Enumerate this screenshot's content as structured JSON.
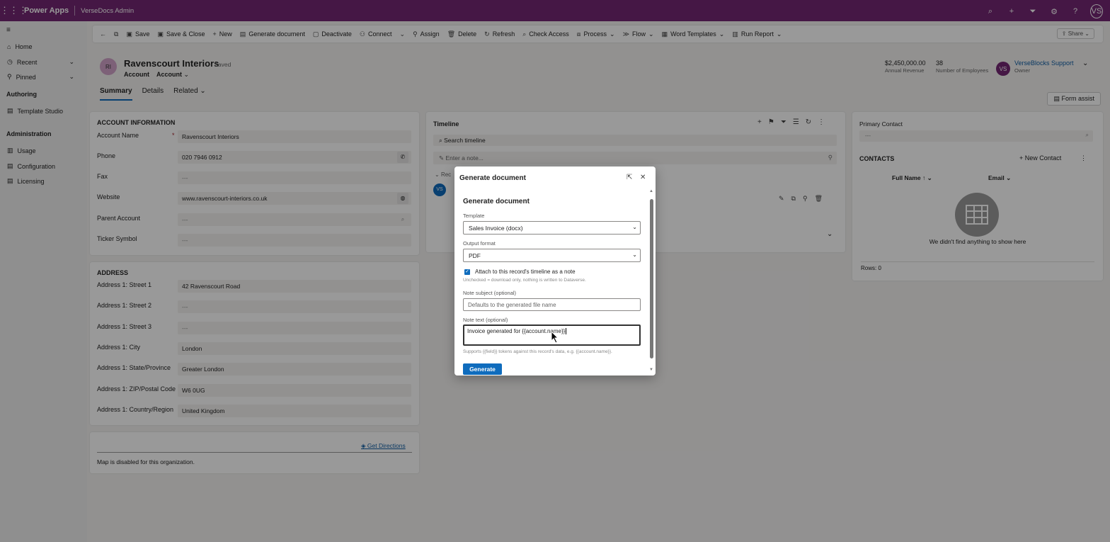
{
  "topbar": {
    "app": "Power Apps",
    "env": "VerseDocs Admin",
    "avatar": "VS"
  },
  "sitemap": {
    "items": [
      {
        "label": "Home",
        "icon": "home-icon"
      },
      {
        "label": "Recent",
        "icon": "clock-icon"
      },
      {
        "label": "Pinned",
        "icon": "pin-icon"
      }
    ],
    "authoring_title": "Authoring",
    "authoring_items": [
      {
        "label": "Template Studio"
      }
    ],
    "admin_title": "Administration",
    "admin_items": [
      {
        "label": "Usage"
      },
      {
        "label": "Configuration"
      },
      {
        "label": "Licensing"
      }
    ]
  },
  "cmdbar": {
    "save": "Save",
    "save_close": "Save & Close",
    "new": "New",
    "generate": "Generate document",
    "deactivate": "Deactivate",
    "connect": "Connect",
    "assign": "Assign",
    "delete": "Delete",
    "refresh": "Refresh",
    "check_access": "Check Access",
    "process": "Process",
    "flow": "Flow",
    "word_templates": "Word Templates",
    "run_report": "Run Report",
    "share": "Share"
  },
  "header": {
    "initials": "RI",
    "title": "Ravenscourt Interiors",
    "saved": "- Saved",
    "entity": "Account",
    "form": "Account",
    "revenue": "$2,450,000.00",
    "revenue_label": "Annual Revenue",
    "employees": "38",
    "employees_label": "Number of Employees",
    "owner_initials": "VS",
    "owner": "VerseBlocks Support",
    "owner_label": "Owner",
    "tabs": [
      "Summary",
      "Details",
      "Related"
    ],
    "form_assist": "Form assist"
  },
  "account_info": {
    "title": "ACCOUNT INFORMATION",
    "fields": [
      {
        "label": "Account Name",
        "value": "Ravenscourt Interiors"
      },
      {
        "label": "Phone",
        "value": "020 7946 0912"
      },
      {
        "label": "Fax",
        "value": "---"
      },
      {
        "label": "Website",
        "value": "www.ravenscourt-interiors.co.uk"
      },
      {
        "label": "Parent Account",
        "value": "---"
      },
      {
        "label": "Ticker Symbol",
        "value": "---"
      }
    ]
  },
  "address": {
    "title": "ADDRESS",
    "fields": [
      {
        "label": "Address 1: Street 1",
        "value": "42 Ravenscourt Road"
      },
      {
        "label": "Address 1: Street 2",
        "value": "---"
      },
      {
        "label": "Address 1: Street 3",
        "value": "---"
      },
      {
        "label": "Address 1: City",
        "value": "London"
      },
      {
        "label": "Address 1: State/Province",
        "value": "Greater London"
      },
      {
        "label": "Address 1: ZIP/Postal Code",
        "value": "W6 0UG"
      },
      {
        "label": "Address 1: Country/Region",
        "value": "United Kingdom"
      }
    ]
  },
  "map": {
    "directions": "Get Directions",
    "disabled": "Map is disabled for this organization."
  },
  "timeline": {
    "title": "Timeline",
    "search_placeholder": "Search timeline",
    "note_placeholder": "Enter a note...",
    "recent": "Rec",
    "avatar": "VS"
  },
  "contacts": {
    "primary_label": "Primary Contact",
    "primary_value": "---",
    "title": "CONTACTS",
    "new_contact": "New Contact",
    "col_name": "Full Name",
    "col_email": "Email",
    "empty": "We didn't find anything to show here",
    "rows": "Rows: 0"
  },
  "modal": {
    "title": "Generate document",
    "heading": "Generate document",
    "template_label": "Template",
    "template_value": "Sales Invoice (docx)",
    "format_label": "Output format",
    "format_value": "PDF",
    "attach_label": "Attach to this record's timeline as a note",
    "attach_help": "Unchecked = download only, nothing is written to Dataverse.",
    "subject_label": "Note subject (optional)",
    "subject_placeholder": "Defaults to the generated file name",
    "text_label": "Note text (optional)",
    "text_value": "Invoice generated for {{account.name}}",
    "tokens_help": "Supports {{field}} tokens against this record's data, e.g. {{account.name}}.",
    "generate": "Generate"
  }
}
